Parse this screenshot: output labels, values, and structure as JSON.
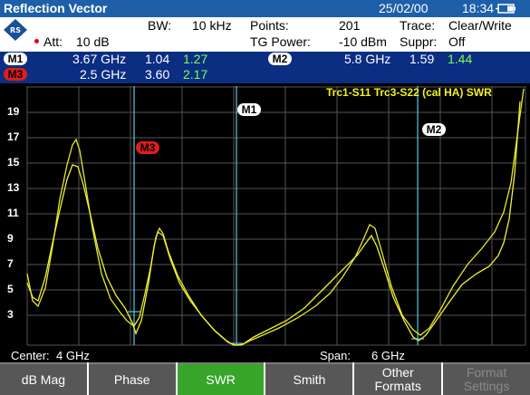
{
  "titlebar": {
    "title": "Reflection Vector",
    "date": "25/02/00",
    "time": "18:34"
  },
  "settings": {
    "att": "Att:",
    "att_val": "10 dB",
    "bw": "BW:",
    "bw_val": "10 kHz",
    "points": "Points:",
    "points_val": "201",
    "trace": "Trace:",
    "trace_val": "Clear/Write",
    "tgpower": "TG Power:",
    "tgpower_val": "-10 dBm",
    "suppr": "Suppr:",
    "suppr_val": "Off"
  },
  "markers": {
    "m1": {
      "label": "M1",
      "freq": "3.67 GHz",
      "v1": "1.04",
      "v2": "1.27"
    },
    "m2": {
      "label": "M2",
      "freq": "5.8 GHz",
      "v1": "1.59",
      "v2": "1.44"
    },
    "m3": {
      "label": "M3",
      "freq": "2.5 GHz",
      "v1": "3.60",
      "v2": "2.17"
    }
  },
  "plot": {
    "trace_label": "Trc1-S11 Trc3-S22 (cal HA) SWR",
    "y_ticks": [
      "19",
      "17",
      "15",
      "13",
      "11",
      "9",
      "7",
      "5",
      "3"
    ]
  },
  "footer": {
    "center_label": "Center:",
    "center_val": "4 GHz",
    "span_label": "Span:",
    "span_val": "6 GHz"
  },
  "softkeys": [
    "dB Mag",
    "Phase",
    "SWR",
    "Smith",
    "Other\nFormats",
    "Format\nSettings"
  ],
  "colors": {
    "trace": "#e8e82a",
    "marker_line": "#56c8e6",
    "active_key": "#36a52a",
    "titlebar": "#1d5fa8"
  }
}
